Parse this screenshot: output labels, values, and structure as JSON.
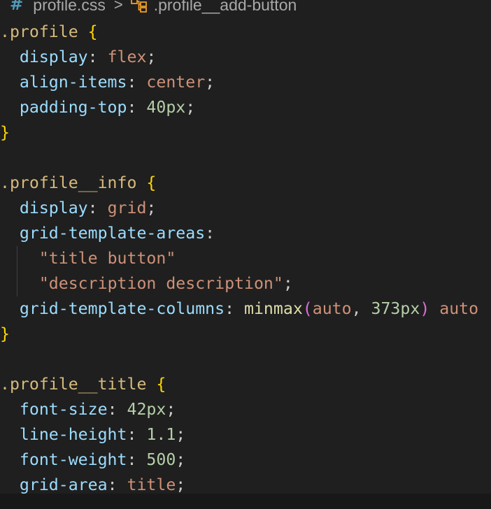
{
  "breadcrumb": {
    "file_icon": "css-hash-icon",
    "file_icon_glyph": "#",
    "file_name": "profile.css",
    "separator": ">",
    "symbol_icon": "class-symbol-icon",
    "symbol_name": ".profile__add-button"
  },
  "code_lines": [
    [
      {
        "t": ".profile",
        "c": "selector"
      },
      {
        "t": " ",
        "c": "punct"
      },
      {
        "t": "{",
        "c": "brace"
      }
    ],
    [
      {
        "t": "  ",
        "c": "punct"
      },
      {
        "t": "display",
        "c": "prop"
      },
      {
        "t": ": ",
        "c": "punct"
      },
      {
        "t": "flex",
        "c": "kw"
      },
      {
        "t": ";",
        "c": "punct"
      }
    ],
    [
      {
        "t": "  ",
        "c": "punct"
      },
      {
        "t": "align-items",
        "c": "prop"
      },
      {
        "t": ": ",
        "c": "punct"
      },
      {
        "t": "center",
        "c": "kw"
      },
      {
        "t": ";",
        "c": "punct"
      }
    ],
    [
      {
        "t": "  ",
        "c": "punct"
      },
      {
        "t": "padding-top",
        "c": "prop"
      },
      {
        "t": ": ",
        "c": "punct"
      },
      {
        "t": "40px",
        "c": "num"
      },
      {
        "t": ";",
        "c": "punct"
      }
    ],
    [
      {
        "t": "}",
        "c": "brace"
      }
    ],
    [],
    [
      {
        "t": ".profile__info",
        "c": "selector"
      },
      {
        "t": " ",
        "c": "punct"
      },
      {
        "t": "{",
        "c": "brace"
      }
    ],
    [
      {
        "t": "  ",
        "c": "punct"
      },
      {
        "t": "display",
        "c": "prop"
      },
      {
        "t": ": ",
        "c": "punct"
      },
      {
        "t": "grid",
        "c": "kw"
      },
      {
        "t": ";",
        "c": "punct"
      }
    ],
    [
      {
        "t": "  ",
        "c": "punct"
      },
      {
        "t": "grid-template-areas",
        "c": "prop"
      },
      {
        "t": ":",
        "c": "punct"
      }
    ],
    [
      {
        "t": "    ",
        "c": "punct",
        "guide": true
      },
      {
        "t": "\"title button\"",
        "c": "str"
      }
    ],
    [
      {
        "t": "    ",
        "c": "punct",
        "guide": true
      },
      {
        "t": "\"description description\"",
        "c": "str"
      },
      {
        "t": ";",
        "c": "punct"
      }
    ],
    [
      {
        "t": "  ",
        "c": "punct"
      },
      {
        "t": "grid-template-columns",
        "c": "prop"
      },
      {
        "t": ": ",
        "c": "punct"
      },
      {
        "t": "minmax",
        "c": "fn"
      },
      {
        "t": "(",
        "c": "paren"
      },
      {
        "t": "auto",
        "c": "kw"
      },
      {
        "t": ", ",
        "c": "punct"
      },
      {
        "t": "373px",
        "c": "num"
      },
      {
        "t": ")",
        "c": "paren"
      },
      {
        "t": " ",
        "c": "punct"
      },
      {
        "t": "auto",
        "c": "kw"
      }
    ],
    [
      {
        "t": "}",
        "c": "brace"
      }
    ],
    [],
    [
      {
        "t": ".profile__title",
        "c": "selector"
      },
      {
        "t": " ",
        "c": "punct"
      },
      {
        "t": "{",
        "c": "brace"
      }
    ],
    [
      {
        "t": "  ",
        "c": "punct"
      },
      {
        "t": "font-size",
        "c": "prop"
      },
      {
        "t": ": ",
        "c": "punct"
      },
      {
        "t": "42px",
        "c": "num"
      },
      {
        "t": ";",
        "c": "punct"
      }
    ],
    [
      {
        "t": "  ",
        "c": "punct"
      },
      {
        "t": "line-height",
        "c": "prop"
      },
      {
        "t": ": ",
        "c": "punct"
      },
      {
        "t": "1.1",
        "c": "num"
      },
      {
        "t": ";",
        "c": "punct"
      }
    ],
    [
      {
        "t": "  ",
        "c": "punct"
      },
      {
        "t": "font-weight",
        "c": "prop"
      },
      {
        "t": ": ",
        "c": "punct"
      },
      {
        "t": "500",
        "c": "num"
      },
      {
        "t": ";",
        "c": "punct"
      }
    ],
    [
      {
        "t": "  ",
        "c": "punct"
      },
      {
        "t": "grid-area",
        "c": "prop"
      },
      {
        "t": ": ",
        "c": "punct"
      },
      {
        "t": "title",
        "c": "kw"
      },
      {
        "t": ";",
        "c": "punct"
      }
    ]
  ]
}
